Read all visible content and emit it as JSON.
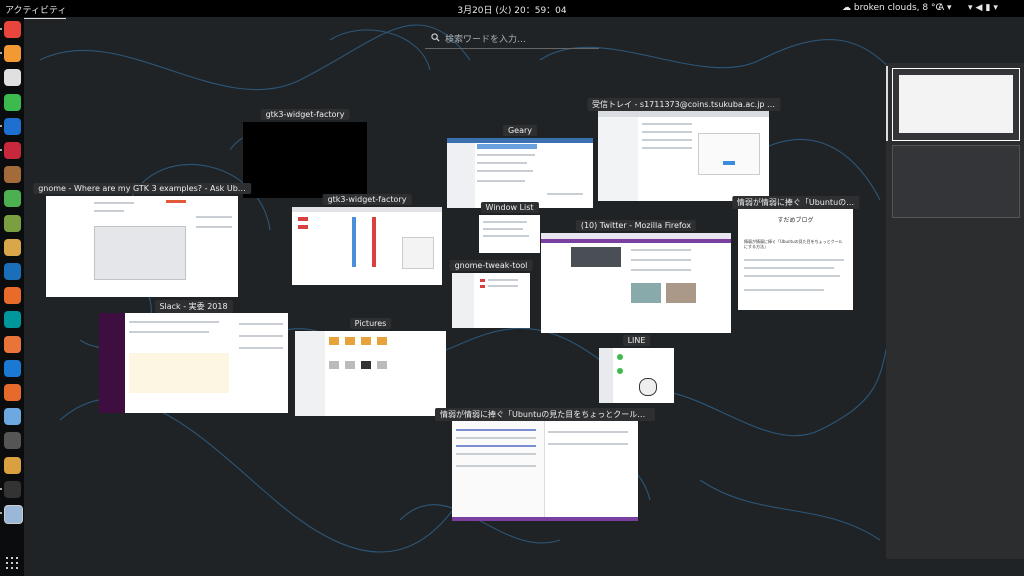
{
  "topbar": {
    "activities": "アクティビティ",
    "clock": "3月20日 (火) 20：59：04",
    "weather": "broken clouds, 8 °C",
    "input_method": "A"
  },
  "search": {
    "placeholder": "検索ワードを入力…"
  },
  "windows": [
    {
      "title": "gtk3-widget-factory"
    },
    {
      "title": "Geary"
    },
    {
      "title": "受信トレイ - s1711373@coins.tsukuba.ac.jp …"
    },
    {
      "title": "gnome - Where are my GTK 3 examples? - Ask Ub…"
    },
    {
      "title": "gtk3-widget-factory"
    },
    {
      "title": "Window List"
    },
    {
      "title": "(10) Twitter - Mozilla Firefox"
    },
    {
      "title": "情弱が情弱に捧ぐ「Ubuntuの…"
    },
    {
      "title": "gnome-tweak-tool"
    },
    {
      "title": "Slack - 実委 2018"
    },
    {
      "title": "Pictures"
    },
    {
      "title": "LINE"
    },
    {
      "title": "情弱が情弱に捧ぐ「Ubuntuの見た目をちょっとクールに…"
    }
  ],
  "dock_icons": [
    "chrome-icon",
    "sublime-icon",
    "app-icon-red",
    "app-icon-green",
    "intellij-icon",
    "rubymine-icon",
    "app-icon-tan",
    "app-icon-gallery",
    "calculator-icon",
    "files-icon",
    "vscode-icon",
    "headphones-icon",
    "arduino-icon",
    "app-icon-orange",
    "virtualbox-icon",
    "firefox-icon",
    "app-icon-blue-circle",
    "settings-icon",
    "app-icon-orange-folder",
    "terminal-icon",
    "app-icon-selected"
  ],
  "colors": {
    "background": "#1f2326",
    "wave_lines": "#2f5f86",
    "topbar": "#000000",
    "dock": "#0b0c0d"
  },
  "blog_window": {
    "heading": "すだめブログ",
    "post_title": "情弱が情弱に捧ぐ「Ubuntuの見た目をちょっとクールにする方法」"
  }
}
